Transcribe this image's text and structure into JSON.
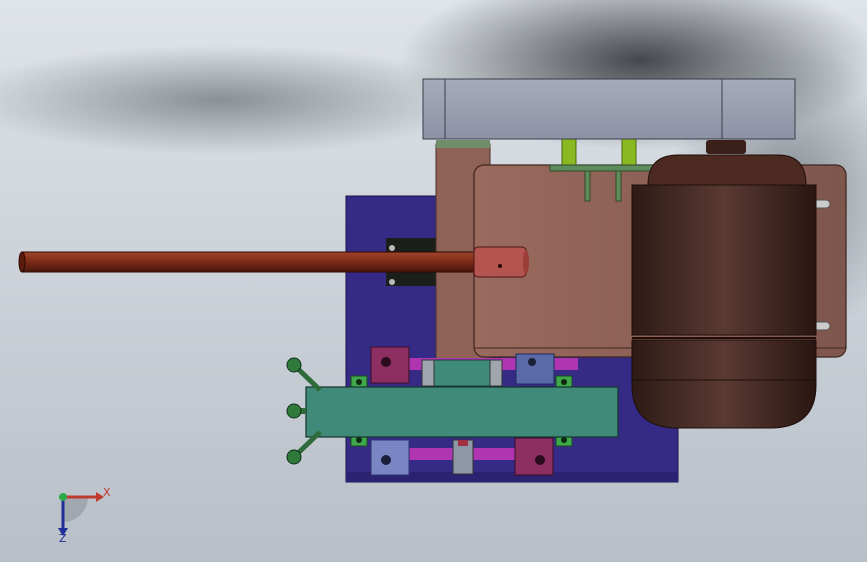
{
  "viewport": {
    "background_top": "#d8dde3",
    "background_bottom": "#b9c0c7"
  },
  "triad": {
    "x_label": "X",
    "z_label": "Z",
    "x_color": "#c0392b",
    "z_color": "#1f2f9a",
    "y_color": "#2fa84a"
  },
  "colors": {
    "base_plate": "#3a2e8c",
    "motor_body": "#4a2a24",
    "housing": "#8a5f55",
    "shaft": "#7a2a1a",
    "bracket": "#3f8a78",
    "handle": "#2f6a3a",
    "rod": "#a83aa8",
    "top_cover": "#9a9eb2",
    "spring": "#8ab820"
  }
}
